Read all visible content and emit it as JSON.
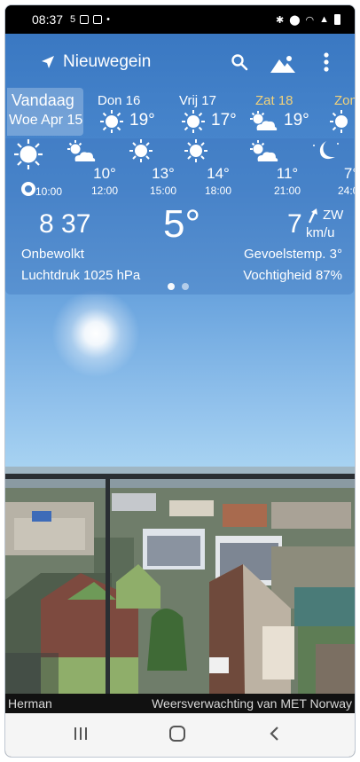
{
  "status": {
    "time": "08:37",
    "icons": [
      "5",
      "A"
    ]
  },
  "app": {
    "city": "Nieuwegein"
  },
  "today": {
    "label": "Vandaag",
    "date": "Woe Apr 15"
  },
  "days": [
    {
      "name": "Don 16",
      "temp": "19°",
      "icon": "sun"
    },
    {
      "name": "Vrij 17",
      "temp": "17°",
      "icon": "sun"
    },
    {
      "name": "Zat 18",
      "temp": "19°",
      "icon": "sun-cloud"
    },
    {
      "name": "Zon",
      "temp": "",
      "icon": "sun"
    }
  ],
  "hours": [
    {
      "temp": "",
      "time": "10:00",
      "icon": "sun-large"
    },
    {
      "temp": "10°",
      "time": "12:00",
      "icon": "sun-cloud"
    },
    {
      "temp": "13°",
      "time": "15:00",
      "icon": "sun"
    },
    {
      "temp": "14°",
      "time": "18:00",
      "icon": "sun"
    },
    {
      "temp": "11°",
      "time": "21:00",
      "icon": "sun-cloud"
    },
    {
      "temp": "7°",
      "time": "24:00",
      "icon": "moon"
    }
  ],
  "current": {
    "time": "8 37",
    "temp": "5°",
    "wind_speed": "7",
    "wind_dir": "ZW",
    "wind_unit": "km/u",
    "description": "Onbewolkt",
    "pressure": "Luchtdruk 1025 hPa",
    "feels_like": "Gevoelstemp. 3°",
    "humidity": "Vochtigheid 87%"
  },
  "photo": {
    "credit_left": "Herman",
    "credit_right": "Weersverwachting van MET Norway"
  },
  "colors": {
    "sky_top": "#3a78c2",
    "sky_bottom": "#a9d4f2",
    "saturday": "#f2d27a"
  }
}
